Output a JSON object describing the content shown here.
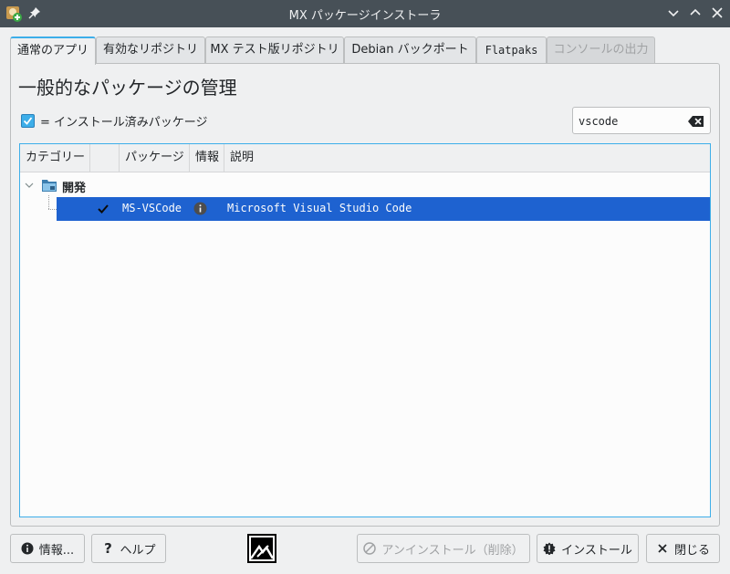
{
  "window": {
    "title": "MX パッケージインストーラ",
    "app_icon": "mx-package-installer-icon",
    "pin_icon": "pin-icon",
    "controls": [
      "minimize-icon",
      "maximize-icon",
      "close-icon"
    ]
  },
  "tabs": [
    {
      "label": "通常のアプリ",
      "active": true,
      "disabled": false
    },
    {
      "label": "有効なリポジトリ",
      "active": false,
      "disabled": false
    },
    {
      "label": "MX テスト版リポジトリ",
      "active": false,
      "disabled": false
    },
    {
      "label": "Debian バックポート",
      "active": false,
      "disabled": false
    },
    {
      "label": "Flatpaks",
      "active": false,
      "disabled": false
    },
    {
      "label": "コンソールの出力",
      "active": false,
      "disabled": true
    }
  ],
  "main": {
    "heading": "一般的なパッケージの管理",
    "legend": "= インストール済みパッケージ",
    "search": {
      "value": "vscode",
      "placeholder": ""
    }
  },
  "tree": {
    "columns": [
      "カテゴリー",
      "",
      "パッケージ",
      "情報",
      "説明"
    ],
    "category": {
      "label": "開発",
      "expanded": true
    },
    "rows": [
      {
        "installed": true,
        "package": "MS-VSCode",
        "info_icon": "info-icon",
        "description": "Microsoft Visual Studio Code",
        "selected": true
      }
    ]
  },
  "buttons": {
    "info": "情報...",
    "help": "ヘルプ",
    "uninstall": "アンインストール（削除）",
    "install": "インストール",
    "close": "閉じる"
  },
  "colors": {
    "accent": "#3daee9",
    "selection": "#1e62d0",
    "titlebar": "#475057"
  }
}
